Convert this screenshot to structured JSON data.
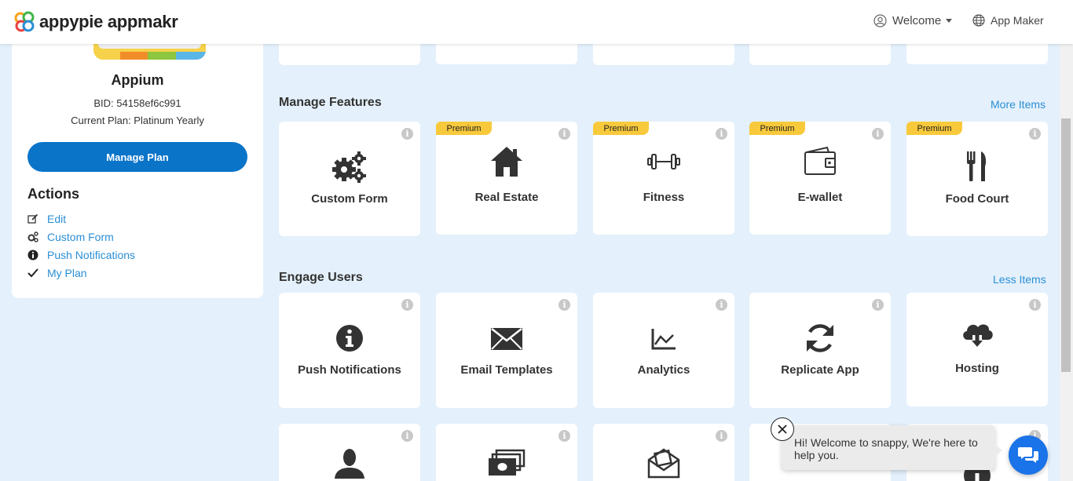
{
  "header": {
    "brand": "appypie appmakr",
    "welcome_label": "Welcome",
    "app_maker_label": "App Maker"
  },
  "sidebar": {
    "app_name": "Appium",
    "bid": "BID: 54158ef6c991",
    "plan": "Current Plan: Platinum Yearly",
    "manage_plan_label": "Manage Plan",
    "actions_title": "Actions",
    "actions": [
      {
        "label": "Edit",
        "icon": "edit-icon"
      },
      {
        "label": "Custom Form",
        "icon": "gears-icon"
      },
      {
        "label": "Push Notifications",
        "icon": "info-icon"
      },
      {
        "label": "My Plan",
        "icon": "check-icon"
      }
    ]
  },
  "sections": {
    "manage_features": {
      "title": "Manage Features",
      "link": "More Items",
      "cards": [
        {
          "label": "Custom Form",
          "icon": "gears-icon",
          "premium": ""
        },
        {
          "label": "Real Estate",
          "icon": "house-icon",
          "premium": "Premium"
        },
        {
          "label": "Fitness",
          "icon": "dumbbell-icon",
          "premium": "Premium"
        },
        {
          "label": "E-wallet",
          "icon": "wallet-icon",
          "premium": "Premium"
        },
        {
          "label": "Food Court",
          "icon": "utensils-icon",
          "premium": "Premium"
        }
      ]
    },
    "engage_users": {
      "title": "Engage Users",
      "link": "Less Items",
      "cards": [
        {
          "label": "Push Notifications",
          "icon": "info-icon"
        },
        {
          "label": "Email Templates",
          "icon": "envelope-icon"
        },
        {
          "label": "Analytics",
          "icon": "chart-icon"
        },
        {
          "label": "Replicate App",
          "icon": "sync-icon"
        },
        {
          "label": "Hosting",
          "icon": "cloud-download-icon"
        }
      ]
    }
  },
  "info_glyph": "i",
  "chat": {
    "message": "Hi! Welcome to snappy, We're here to help you."
  },
  "colors": {
    "accent": "#0a74c9",
    "link": "#2a8fd6",
    "premium": "#f8c93b",
    "background": "#e4f0fb"
  }
}
